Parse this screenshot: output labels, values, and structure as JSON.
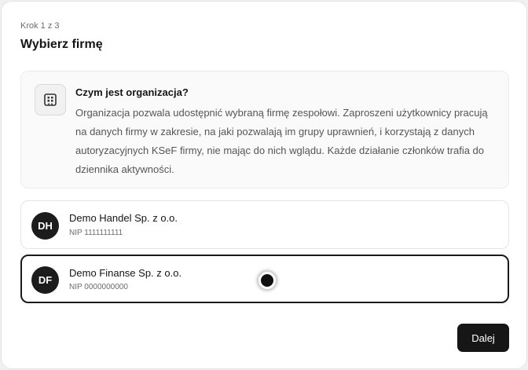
{
  "wizard": {
    "step_label": "Krok 1 z 3",
    "title": "Wybierz firmę"
  },
  "info": {
    "icon": "building-icon",
    "heading": "Czym jest organizacja?",
    "body": "Organizacja pozwala udostępnić wybraną firmę zespołowi. Zaproszeni użytkownicy pracują na danych firmy w zakresie, na jaki pozwalają im grupy uprawnień, i korzystają z danych autoryzacyjnych KSeF firmy, nie mając do nich wglądu. Każde działanie członków trafia do dziennika aktywności."
  },
  "companies": [
    {
      "initials": "DH",
      "name": "Demo Handel Sp. z o.o.",
      "nip": "NIP 1111111111",
      "selected": false
    },
    {
      "initials": "DF",
      "name": "Demo Finanse Sp. z o.o.",
      "nip": "NIP 0000000000",
      "selected": true
    }
  ],
  "actions": {
    "next_label": "Dalej"
  },
  "colors": {
    "accent": "#161616",
    "card_bg": "#ffffff",
    "info_bg": "#fafafa",
    "muted_text": "#555555"
  }
}
